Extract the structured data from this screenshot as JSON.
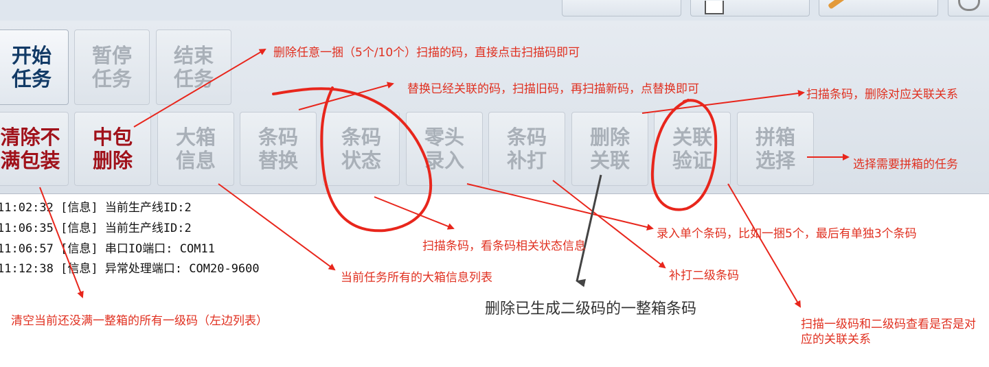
{
  "colors": {
    "annotation": "#e8261c",
    "primary_text": "#123a66",
    "danger_text": "#a0111a",
    "disabled_text": "#a9b0b8"
  },
  "top_icons": [
    "calendar-icon",
    "tools-icon",
    "gear-icon"
  ],
  "toolbar": {
    "row1": [
      {
        "label": "开始\n任务",
        "state": "enabled"
      },
      {
        "label": "暂停\n任务",
        "state": "disabled"
      },
      {
        "label": "结束\n任务",
        "state": "disabled"
      }
    ],
    "row2": [
      {
        "label": "清除不\n满包装",
        "state": "danger"
      },
      {
        "label": "中包\n删除",
        "state": "danger"
      },
      {
        "label": "大箱\n信息",
        "state": "disabled"
      },
      {
        "label": "条码\n替换",
        "state": "disabled"
      },
      {
        "label": "条码\n状态",
        "state": "disabled"
      },
      {
        "label": "零头\n录入",
        "state": "disabled"
      },
      {
        "label": "条码\n补打",
        "state": "disabled"
      },
      {
        "label": "删除\n关联",
        "state": "disabled"
      },
      {
        "label": "关联\n验证",
        "state": "disabled"
      },
      {
        "label": "拼箱\n选择",
        "state": "disabled"
      }
    ]
  },
  "log": [
    "11:02:32 [信息] 当前生产线ID:2",
    "11:06:35 [信息] 当前生产线ID:2",
    "11:06:57 [信息] 串口IO端口: COM11",
    "11:12:38 [信息] 异常处理端口: COM20-9600"
  ],
  "annotations": {
    "mid_pack_delete": "删除任意一捆（5个/10个）扫描的码，直接点击扫描码即可",
    "barcode_replace": "替换已经关联的码，扫描旧码，再扫描新码，点替换即可",
    "delete_link": "扫描条码，删除对应关联关系",
    "combine_select": "选择需要拼箱的任务",
    "odd_entry": "录入单个条码，比如一捆5个，最后有单独3个条码",
    "barcode_status": "扫描条码，看条码相关状态信息",
    "box_info": "当前任务所有的大箱信息列表",
    "reprint": "补打二级条码",
    "clear_partial": "清空当前还没满一整箱的所有一级码（左边列表）",
    "delete_box": "删除已生成二级码的一整箱条码",
    "verify_link": "扫描一级码和二级码查看是否是对应的关联关系"
  }
}
